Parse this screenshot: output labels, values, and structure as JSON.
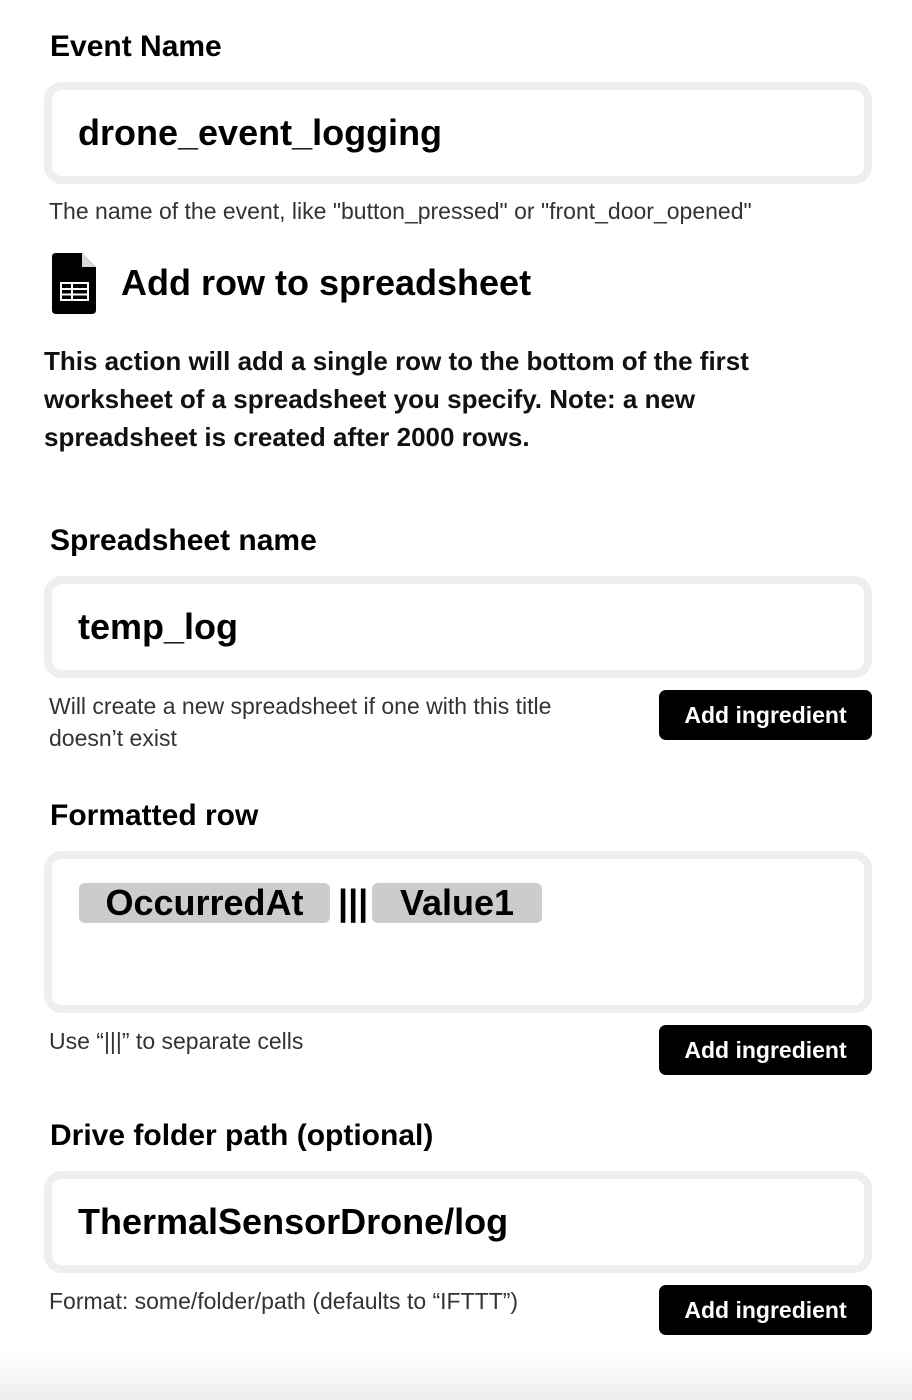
{
  "event_name": {
    "label": "Event Name",
    "value": "drone_event_logging",
    "helper": "The name of the event, like \"button_pressed\" or \"front_door_opened\""
  },
  "action": {
    "icon": "spreadsheet-icon",
    "title": "Add row to spreadsheet",
    "description": "This action will add a single row to the bottom of the first worksheet of a spreadsheet you specify. Note: a new spreadsheet is created after 2000 rows."
  },
  "spreadsheet_name": {
    "label": "Spreadsheet name",
    "value": "temp_log",
    "helper": "Will create a new spreadsheet if one with this title doesn’t exist",
    "button": "Add ingredient"
  },
  "formatted_row": {
    "label": "Formatted row",
    "ingredients": [
      "OccurredAt",
      "Value1"
    ],
    "separator": "|||",
    "helper": "Use “|||” to separate cells",
    "button": "Add ingredient"
  },
  "drive_folder": {
    "label": "Drive folder path (optional)",
    "value": "ThermalSensorDrone/log",
    "helper": "Format: some/folder/path (defaults to “IFTTT”)",
    "button": "Add ingredient"
  }
}
